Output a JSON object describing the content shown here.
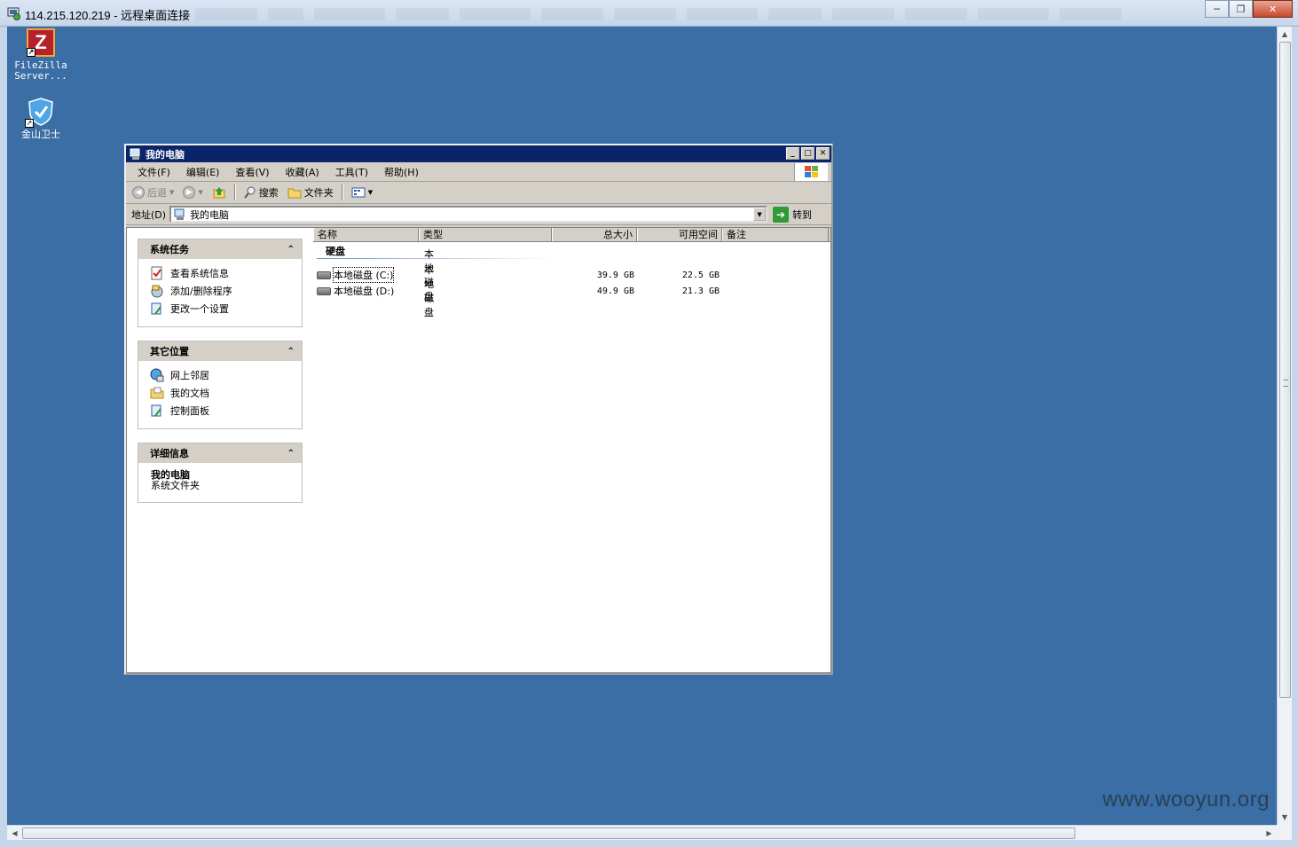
{
  "rdp": {
    "title": "114.215.120.219 - 远程桌面连接",
    "controls": {
      "minimize": "─",
      "restore": "❐",
      "close": "✕"
    }
  },
  "desktop": {
    "background": "#3a6ea5",
    "icons": [
      {
        "label_line1": "FileZilla",
        "label_line2": "Server...",
        "icon": "filezilla-icon"
      },
      {
        "label_line1": "金山卫士",
        "label_line2": "",
        "icon": "shield-icon"
      }
    ]
  },
  "explorer": {
    "title": "我的电脑",
    "menu": [
      "文件(F)",
      "编辑(E)",
      "查看(V)",
      "收藏(A)",
      "工具(T)",
      "帮助(H)"
    ],
    "toolbar": {
      "back": "后退",
      "search": "搜索",
      "folders": "文件夹"
    },
    "address": {
      "label": "地址(D)",
      "value": "我的电脑",
      "go": "转到"
    },
    "taskpane": {
      "system_tasks": {
        "title": "系统任务",
        "items": [
          "查看系统信息",
          "添加/删除程序",
          "更改一个设置"
        ]
      },
      "other_places": {
        "title": "其它位置",
        "items": [
          "网上邻居",
          "我的文档",
          "控制面板"
        ]
      },
      "details": {
        "title": "详细信息",
        "name": "我的电脑",
        "desc": "系统文件夹"
      }
    },
    "columns": [
      "名称",
      "类型",
      "总大小",
      "可用空间",
      "备注"
    ],
    "group": "硬盘",
    "drives": [
      {
        "name": "本地磁盘 (C:)",
        "type": "本地磁盘",
        "total": "39.9 GB",
        "free": "22.5 GB"
      },
      {
        "name": "本地磁盘 (D:)",
        "type": "本地磁盘",
        "total": "49.9 GB",
        "free": "21.3 GB"
      }
    ]
  },
  "watermark": "www.wooyun.org"
}
